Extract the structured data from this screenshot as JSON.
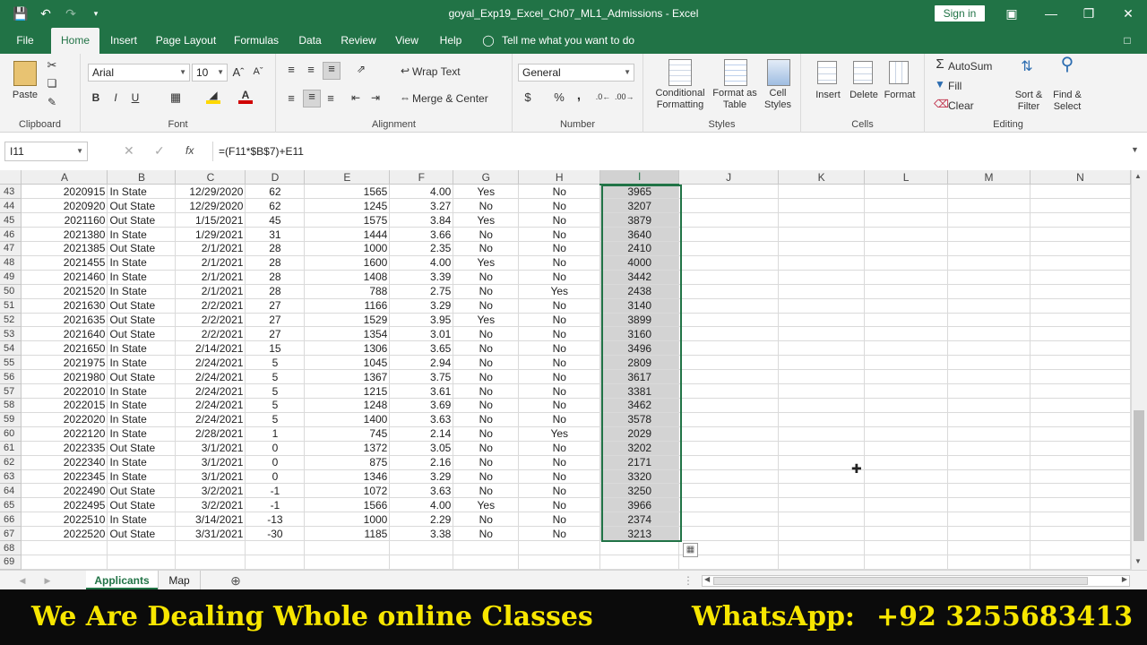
{
  "title_bar": {
    "window_title": "goyal_Exp19_Excel_Ch07_ML1_Admissions  -  Excel",
    "sign_in": "Sign in",
    "qat_icons": [
      "save-icon",
      "undo-icon",
      "redo-icon",
      "customize-qat-icon"
    ],
    "window_controls": [
      "ribbon-display-icon",
      "minimize-icon",
      "restore-icon",
      "close-icon"
    ]
  },
  "ribbon_tabs": [
    "File",
    "Home",
    "Insert",
    "Page Layout",
    "Formulas",
    "Data",
    "Review",
    "View",
    "Help"
  ],
  "tell_me": "Tell me what you want to do",
  "ribbon": {
    "clipboard": {
      "label": "Clipboard",
      "paste": "Paste"
    },
    "font": {
      "label": "Font",
      "name": "Arial",
      "size": "10",
      "bold": "B",
      "italic": "I",
      "underline": "U"
    },
    "alignment": {
      "label": "Alignment",
      "wrap": "Wrap Text",
      "merge": "Merge & Center"
    },
    "number": {
      "label": "Number",
      "format": "General",
      "currency": "$",
      "percent": "%",
      "comma": ","
    },
    "styles": {
      "label": "Styles",
      "conditional": "Conditional",
      "conditional2": "Formatting",
      "format_as": "Format as",
      "format_as2": "Table",
      "cell": "Cell",
      "cell2": "Styles"
    },
    "cells": {
      "label": "Cells",
      "insert": "Insert",
      "delete": "Delete",
      "format": "Format"
    },
    "editing": {
      "label": "Editing",
      "autosum": "AutoSum",
      "fill": "Fill",
      "clear": "Clear",
      "sort": "Sort &",
      "sort2": "Filter",
      "find": "Find &",
      "find2": "Select"
    }
  },
  "formula_bar": {
    "name_box": "I11",
    "fx": "fx",
    "formula": "=(F11*$B$7)+E11"
  },
  "columns": [
    "A",
    "B",
    "C",
    "D",
    "E",
    "F",
    "G",
    "H",
    "I",
    "J",
    "K",
    "L",
    "M",
    "N"
  ],
  "rows": [
    {
      "n": "43",
      "a": "2020915",
      "b": "In State",
      "c": "12/29/2020",
      "d": "62",
      "e": "1565",
      "f": "4.00",
      "g": "Yes",
      "h": "No",
      "i": "3965"
    },
    {
      "n": "44",
      "a": "2020920",
      "b": "Out State",
      "c": "12/29/2020",
      "d": "62",
      "e": "1245",
      "f": "3.27",
      "g": "No",
      "h": "No",
      "i": "3207"
    },
    {
      "n": "45",
      "a": "2021160",
      "b": "Out State",
      "c": "1/15/2021",
      "d": "45",
      "e": "1575",
      "f": "3.84",
      "g": "Yes",
      "h": "No",
      "i": "3879"
    },
    {
      "n": "46",
      "a": "2021380",
      "b": "In State",
      "c": "1/29/2021",
      "d": "31",
      "e": "1444",
      "f": "3.66",
      "g": "No",
      "h": "No",
      "i": "3640"
    },
    {
      "n": "47",
      "a": "2021385",
      "b": "Out State",
      "c": "2/1/2021",
      "d": "28",
      "e": "1000",
      "f": "2.35",
      "g": "No",
      "h": "No",
      "i": "2410"
    },
    {
      "n": "48",
      "a": "2021455",
      "b": "In State",
      "c": "2/1/2021",
      "d": "28",
      "e": "1600",
      "f": "4.00",
      "g": "Yes",
      "h": "No",
      "i": "4000"
    },
    {
      "n": "49",
      "a": "2021460",
      "b": "In State",
      "c": "2/1/2021",
      "d": "28",
      "e": "1408",
      "f": "3.39",
      "g": "No",
      "h": "No",
      "i": "3442"
    },
    {
      "n": "50",
      "a": "2021520",
      "b": "In State",
      "c": "2/1/2021",
      "d": "28",
      "e": "788",
      "f": "2.75",
      "g": "No",
      "h": "Yes",
      "i": "2438"
    },
    {
      "n": "51",
      "a": "2021630",
      "b": "Out State",
      "c": "2/2/2021",
      "d": "27",
      "e": "1166",
      "f": "3.29",
      "g": "No",
      "h": "No",
      "i": "3140"
    },
    {
      "n": "52",
      "a": "2021635",
      "b": "Out State",
      "c": "2/2/2021",
      "d": "27",
      "e": "1529",
      "f": "3.95",
      "g": "Yes",
      "h": "No",
      "i": "3899"
    },
    {
      "n": "53",
      "a": "2021640",
      "b": "Out State",
      "c": "2/2/2021",
      "d": "27",
      "e": "1354",
      "f": "3.01",
      "g": "No",
      "h": "No",
      "i": "3160"
    },
    {
      "n": "54",
      "a": "2021650",
      "b": "In State",
      "c": "2/14/2021",
      "d": "15",
      "e": "1306",
      "f": "3.65",
      "g": "No",
      "h": "No",
      "i": "3496"
    },
    {
      "n": "55",
      "a": "2021975",
      "b": "In State",
      "c": "2/24/2021",
      "d": "5",
      "e": "1045",
      "f": "2.94",
      "g": "No",
      "h": "No",
      "i": "2809"
    },
    {
      "n": "56",
      "a": "2021980",
      "b": "Out State",
      "c": "2/24/2021",
      "d": "5",
      "e": "1367",
      "f": "3.75",
      "g": "No",
      "h": "No",
      "i": "3617"
    },
    {
      "n": "57",
      "a": "2022010",
      "b": "In State",
      "c": "2/24/2021",
      "d": "5",
      "e": "1215",
      "f": "3.61",
      "g": "No",
      "h": "No",
      "i": "3381"
    },
    {
      "n": "58",
      "a": "2022015",
      "b": "In State",
      "c": "2/24/2021",
      "d": "5",
      "e": "1248",
      "f": "3.69",
      "g": "No",
      "h": "No",
      "i": "3462"
    },
    {
      "n": "59",
      "a": "2022020",
      "b": "In State",
      "c": "2/24/2021",
      "d": "5",
      "e": "1400",
      "f": "3.63",
      "g": "No",
      "h": "No",
      "i": "3578"
    },
    {
      "n": "60",
      "a": "2022120",
      "b": "In State",
      "c": "2/28/2021",
      "d": "1",
      "e": "745",
      "f": "2.14",
      "g": "No",
      "h": "Yes",
      "i": "2029"
    },
    {
      "n": "61",
      "a": "2022335",
      "b": "Out State",
      "c": "3/1/2021",
      "d": "0",
      "e": "1372",
      "f": "3.05",
      "g": "No",
      "h": "No",
      "i": "3202"
    },
    {
      "n": "62",
      "a": "2022340",
      "b": "In State",
      "c": "3/1/2021",
      "d": "0",
      "e": "875",
      "f": "2.16",
      "g": "No",
      "h": "No",
      "i": "2171"
    },
    {
      "n": "63",
      "a": "2022345",
      "b": "In State",
      "c": "3/1/2021",
      "d": "0",
      "e": "1346",
      "f": "3.29",
      "g": "No",
      "h": "No",
      "i": "3320"
    },
    {
      "n": "64",
      "a": "2022490",
      "b": "Out State",
      "c": "3/2/2021",
      "d": "-1",
      "e": "1072",
      "f": "3.63",
      "g": "No",
      "h": "No",
      "i": "3250"
    },
    {
      "n": "65",
      "a": "2022495",
      "b": "Out State",
      "c": "3/2/2021",
      "d": "-1",
      "e": "1566",
      "f": "4.00",
      "g": "Yes",
      "h": "No",
      "i": "3966"
    },
    {
      "n": "66",
      "a": "2022510",
      "b": "In State",
      "c": "3/14/2021",
      "d": "-13",
      "e": "1000",
      "f": "2.29",
      "g": "No",
      "h": "No",
      "i": "2374"
    },
    {
      "n": "67",
      "a": "2022520",
      "b": "Out State",
      "c": "3/31/2021",
      "d": "-30",
      "e": "1185",
      "f": "3.38",
      "g": "No",
      "h": "No",
      "i": "3213"
    },
    {
      "n": "68",
      "a": "",
      "b": "",
      "c": "",
      "d": "",
      "e": "",
      "f": "",
      "g": "",
      "h": "",
      "i": ""
    },
    {
      "n": "69",
      "a": "",
      "b": "",
      "c": "",
      "d": "",
      "e": "",
      "f": "",
      "g": "",
      "h": "",
      "i": ""
    }
  ],
  "sheet_tabs": [
    "Applicants",
    "Map"
  ],
  "banner": {
    "left": "We Are Dealing Whole online Classes",
    "whatsapp": "WhatsApp:",
    "phone": "+92 3255683413"
  },
  "colors": {
    "excel_green": "#217346",
    "banner_text": "#f7e600",
    "banner_bg": "#0b0b0b"
  }
}
